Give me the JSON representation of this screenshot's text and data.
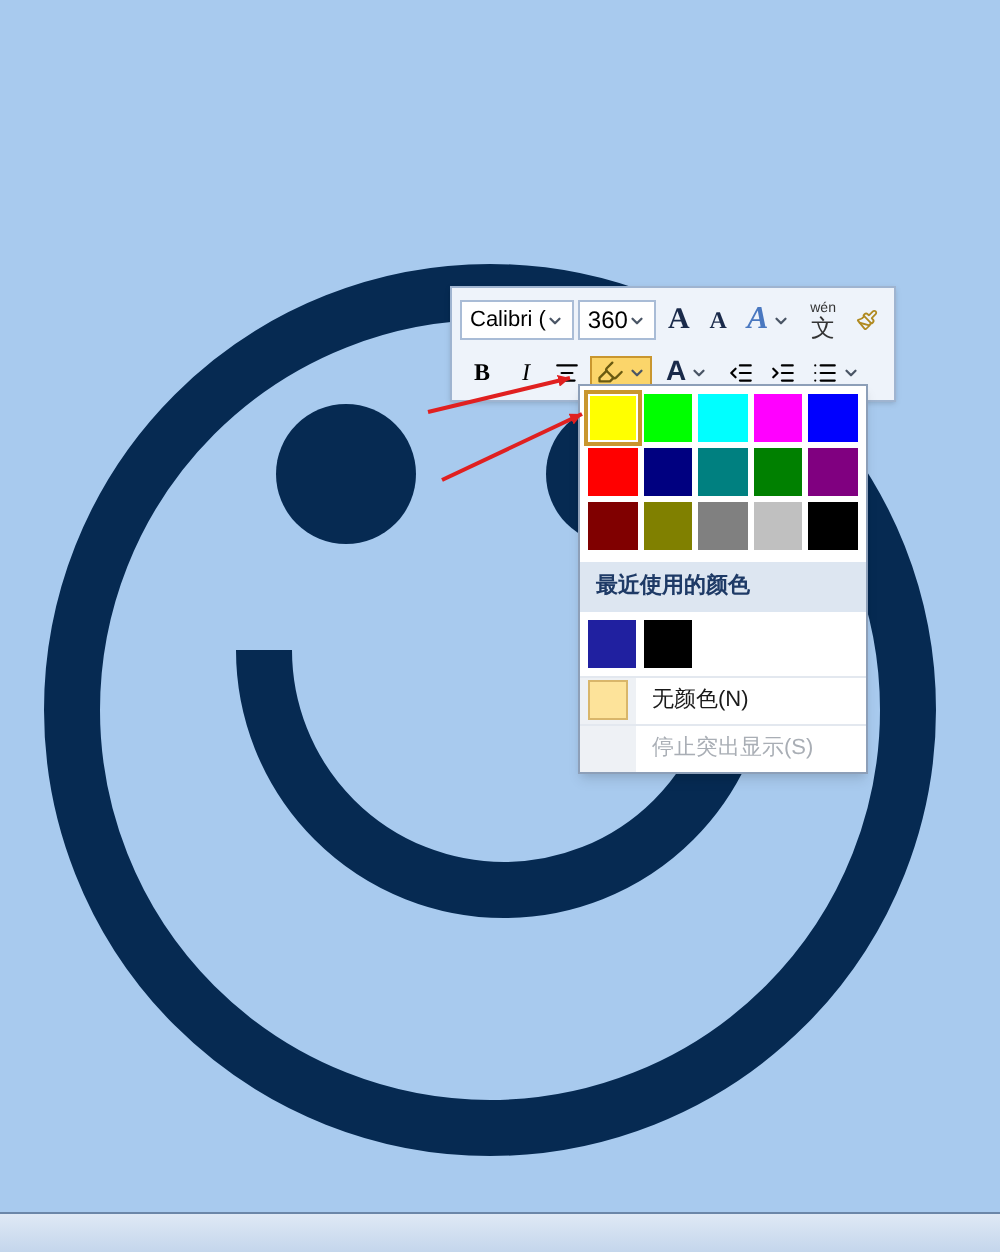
{
  "mini_toolbar": {
    "font_name": "Calibri (",
    "font_size": "360",
    "row_1": [
      {
        "kind": "grow",
        "label": "A"
      },
      {
        "kind": "shrink",
        "label": "A"
      },
      {
        "kind": "effects",
        "label": "A"
      },
      {
        "kind": "phonetic",
        "label": "文",
        "ruby": "wén"
      },
      {
        "kind": "brush"
      }
    ],
    "row_2": [
      {
        "kind": "bold",
        "label": "B",
        "pressed": false
      },
      {
        "kind": "italic",
        "label": "I",
        "pressed": false
      },
      {
        "kind": "center",
        "pressed": false
      },
      {
        "kind": "highlight",
        "pressed": true
      },
      {
        "kind": "font_color",
        "label": "A",
        "pressed": false
      },
      {
        "kind": "outdent",
        "pressed": false
      },
      {
        "kind": "indent",
        "pressed": false
      },
      {
        "kind": "bullets",
        "pressed": false
      }
    ]
  },
  "highlight_menu": {
    "colors": [
      {
        "color": "#ffff00",
        "selected": true
      },
      {
        "color": "#00ff00",
        "selected": false
      },
      {
        "color": "#00ffff",
        "selected": false
      },
      {
        "color": "#ff00ff",
        "selected": false
      },
      {
        "color": "#0000ff",
        "selected": false
      },
      {
        "color": "#ff0000",
        "selected": false
      },
      {
        "color": "#000080",
        "selected": false
      },
      {
        "color": "#008080",
        "selected": false
      },
      {
        "color": "#008000",
        "selected": false
      },
      {
        "color": "#800080",
        "selected": false
      },
      {
        "color": "#800000",
        "selected": false
      },
      {
        "color": "#808000",
        "selected": false
      },
      {
        "color": "#808080",
        "selected": false
      },
      {
        "color": "#c0c0c0",
        "selected": false
      },
      {
        "color": "#000000",
        "selected": false
      }
    ],
    "recent_heading": "最近使用的颜色",
    "recent_colors": [
      {
        "color": "#2020a0"
      },
      {
        "color": "#000000"
      }
    ],
    "items": [
      {
        "kind": "no_color",
        "label": "无颜色(N)",
        "disabled": false
      },
      {
        "kind": "stop",
        "label": "停止突出显示(S)",
        "disabled": true
      }
    ]
  }
}
